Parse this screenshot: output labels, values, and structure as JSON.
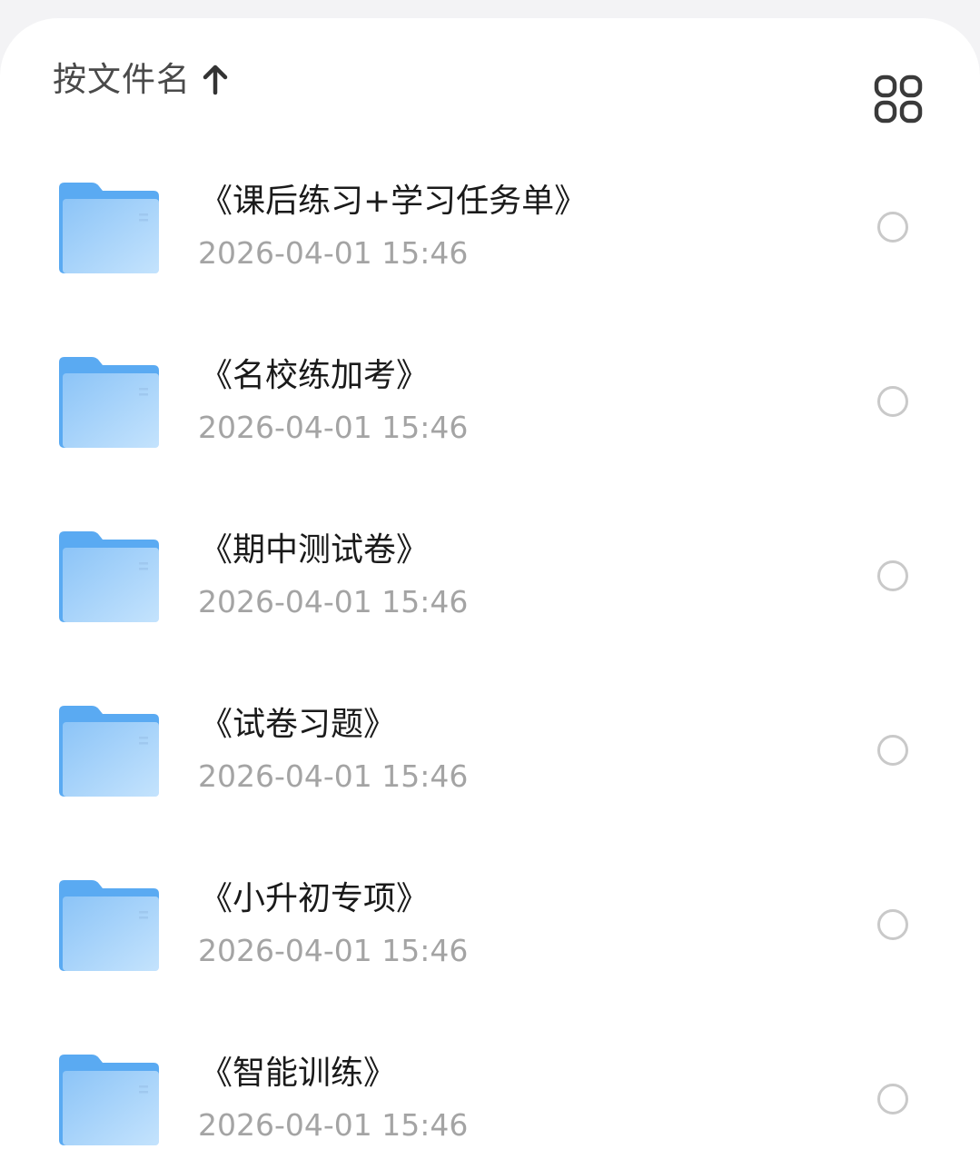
{
  "header": {
    "sort_label": "按文件名",
    "sort_direction_icon": "arrow-up-icon",
    "view_toggle_icon": "grid-view-icon"
  },
  "colors": {
    "folder_light": "#a9d3fb",
    "folder_dark": "#5aaaf2",
    "text_primary": "#1a1a1a",
    "text_secondary": "#a4a4a4"
  },
  "files": [
    {
      "name": "《课后练习+学习任务单》",
      "date": "2026-04-01 15:46"
    },
    {
      "name": "《名校练加考》",
      "date": "2026-04-01 15:46"
    },
    {
      "name": "《期中测试卷》",
      "date": "2026-04-01 15:46"
    },
    {
      "name": "《试卷习题》",
      "date": "2026-04-01 15:46"
    },
    {
      "name": "《小升初专项》",
      "date": "2026-04-01 15:46"
    },
    {
      "name": "《智能训练》",
      "date": "2026-04-01 15:46"
    }
  ]
}
